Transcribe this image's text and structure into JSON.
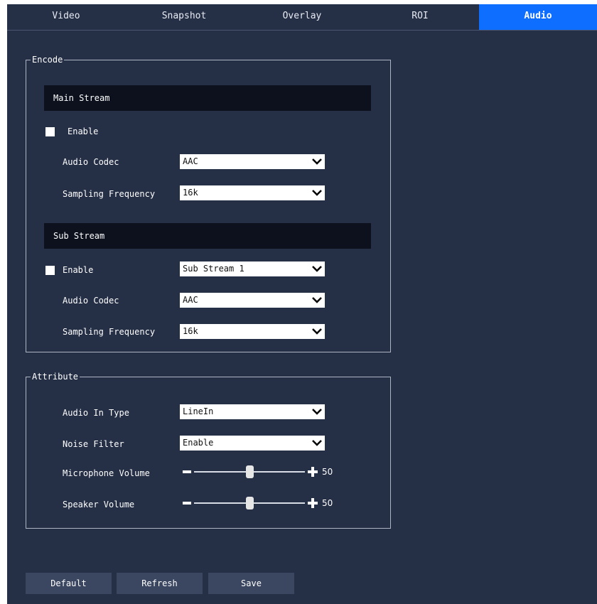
{
  "tabs": [
    {
      "label": "Video",
      "active": false
    },
    {
      "label": "Snapshot",
      "active": false
    },
    {
      "label": "Overlay",
      "active": false
    },
    {
      "label": "ROI",
      "active": false
    },
    {
      "label": "Audio",
      "active": true
    }
  ],
  "encode": {
    "legend": "Encode",
    "main_stream": {
      "title": "Main Stream",
      "enable_label": "Enable",
      "enabled": false,
      "codec_label": "Audio Codec",
      "codec_value": "AAC",
      "freq_label": "Sampling Frequency",
      "freq_value": "16k"
    },
    "sub_stream": {
      "title": "Sub Stream",
      "enable_label": "Enable",
      "enabled": false,
      "stream_value": "Sub Stream 1",
      "codec_label": "Audio Codec",
      "codec_value": "AAC",
      "freq_label": "Sampling Frequency",
      "freq_value": "16k"
    }
  },
  "attribute": {
    "legend": "Attribute",
    "audio_in_label": "Audio In Type",
    "audio_in_value": "LineIn",
    "noise_label": "Noise Filter",
    "noise_value": "Enable",
    "mic_label": "Microphone Volume",
    "mic_value": 50,
    "speaker_label": "Speaker Volume",
    "speaker_value": 50
  },
  "buttons": {
    "default": "Default",
    "refresh": "Refresh",
    "save": "Save"
  },
  "colors": {
    "background": "#252f46",
    "tab_active": "#0e6eff",
    "stream_bar": "#0c111d",
    "button": "#3b4761"
  },
  "icons": {
    "dropdown": "chevron-down-icon",
    "minus": "minus-icon",
    "plus": "plus-icon"
  }
}
